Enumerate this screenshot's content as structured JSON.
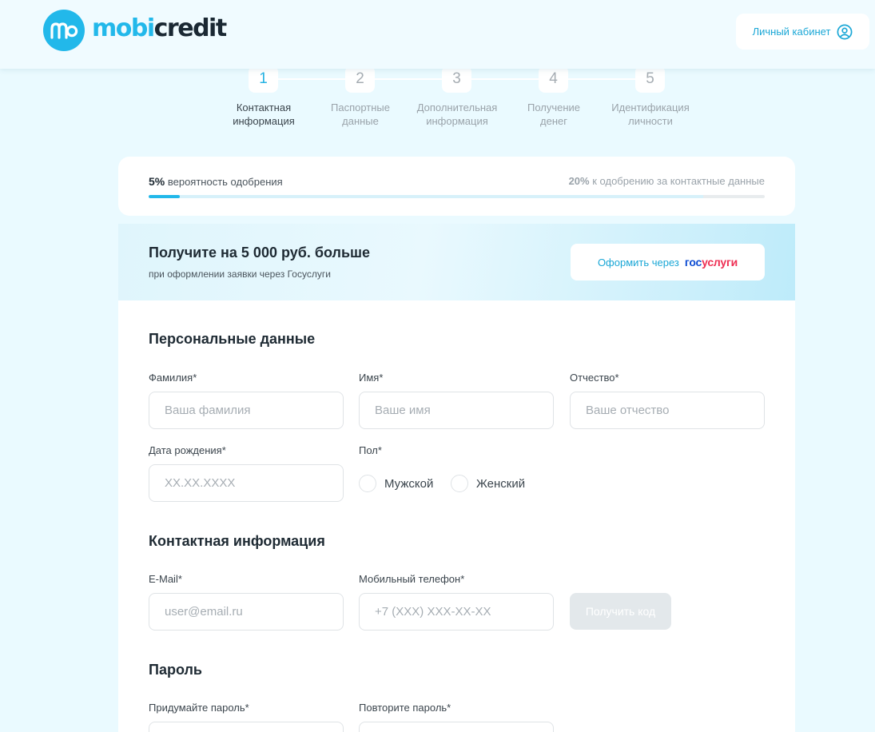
{
  "header": {
    "logo_text_mobi": "mobi",
    "logo_text_credit": "credit",
    "cabinet_label": "Личный кабинет"
  },
  "steps": [
    {
      "number": "1",
      "line1": "Контактная",
      "line2": "информация",
      "active": true
    },
    {
      "number": "2",
      "line1": "Паспортные",
      "line2": "данные",
      "active": false
    },
    {
      "number": "3",
      "line1": "Дополнительная",
      "line2": "информация",
      "active": false
    },
    {
      "number": "4",
      "line1": "Получение",
      "line2": "денег",
      "active": false
    },
    {
      "number": "5",
      "line1": "Идентификация",
      "line2": "личности",
      "active": false
    }
  ],
  "progress": {
    "current_percent": "5%",
    "current_text": "вероятность одобрения",
    "bonus_percent": "20%",
    "bonus_text": "к одобрению за контактные данные",
    "current_value": 0.05,
    "potential_value": 0.9
  },
  "banner": {
    "title": "Получите на 5 000 руб. больше",
    "subtitle": "при оформлении заявки через Госуслуги",
    "button_text": "Оформить через",
    "gos_part1": "гос",
    "gos_part2": "услуги"
  },
  "personal": {
    "title": "Персональные данные",
    "lastname_label": "Фамилия*",
    "lastname_placeholder": "Ваша фамилия",
    "firstname_label": "Имя*",
    "firstname_placeholder": "Ваше имя",
    "middlename_label": "Отчество*",
    "middlename_placeholder": "Ваше отчество",
    "birthdate_label": "Дата рождения*",
    "birthdate_placeholder": "XX.XX.XXXX",
    "gender_label": "Пол*",
    "gender_male": "Мужской",
    "gender_female": "Женский"
  },
  "contact": {
    "title": "Контактная информация",
    "email_label": "E-Mail*",
    "email_placeholder": "user@email.ru",
    "phone_label": "Мобильный телефон*",
    "phone_placeholder": "+7 (XXX) XXX-XX-XX",
    "code_button": "Получить код"
  },
  "password": {
    "title": "Пароль",
    "create_label": "Придумайте пароль*",
    "repeat_label": "Повторите пароль*"
  },
  "colors": {
    "brand": "#22b8ea",
    "page_bg": "#eafaff",
    "text_dark": "#1e2a33"
  }
}
